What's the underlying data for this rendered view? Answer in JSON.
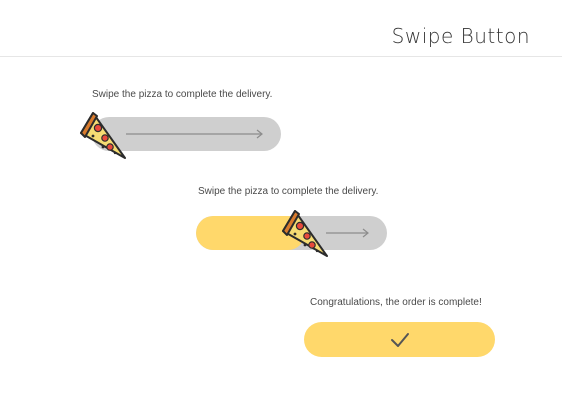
{
  "header": {
    "title": "Swipe Button"
  },
  "swipe_1": {
    "instruction": "Swipe the pizza to complete the delivery.",
    "progress": 0
  },
  "swipe_2": {
    "instruction": "Swipe the pizza to complete the delivery.",
    "progress": 0.57
  },
  "complete": {
    "message": "Congratulations, the order is complete!"
  },
  "colors": {
    "accent": "#ffd86b",
    "track": "#cfcfcf",
    "pizza_crust": "#d97b2d",
    "pepperoni": "#e84a3c"
  },
  "icons": {
    "slider_thumb": "pizza-slice-icon",
    "arrow": "arrow-right-icon",
    "done": "checkmark-icon"
  }
}
